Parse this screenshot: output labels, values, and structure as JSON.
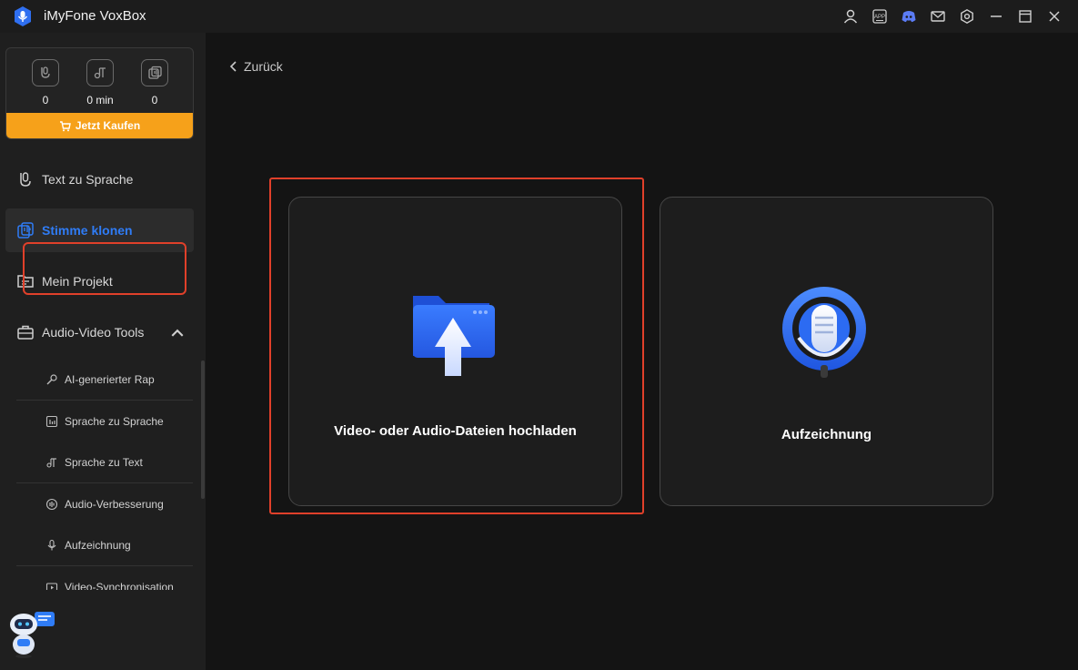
{
  "app": {
    "title": "iMyFone VoxBox"
  },
  "titlebar": {
    "icons": [
      "user-icon",
      "app-icon",
      "discord-icon",
      "mail-icon",
      "settings-icon",
      "minimize-icon",
      "maximize-icon",
      "close-icon"
    ],
    "app_icon_label": "APP"
  },
  "quota": {
    "items": [
      {
        "icon": "text-to-speech-quota-icon",
        "value": "0"
      },
      {
        "icon": "time-quota-icon",
        "value": "0 min"
      },
      {
        "icon": "voice-clone-quota-icon",
        "value": "0"
      }
    ],
    "buy_label": "Jetzt Kaufen",
    "buy_color": "#f6a11a"
  },
  "nav": {
    "items": [
      {
        "label": "Text zu Sprache",
        "icon": "text-to-speech-icon"
      },
      {
        "label": "Stimme klonen",
        "icon": "voice-clone-icon",
        "active": true
      },
      {
        "label": "Mein Projekt",
        "icon": "folder-icon"
      },
      {
        "label": "Audio-Video Tools",
        "icon": "toolbox-icon",
        "expanded": true
      }
    ],
    "sub_items": [
      {
        "label": "AI-generierter Rap",
        "icon": "mic-rap-icon"
      },
      {
        "label": "Sprache zu Sprache",
        "icon": "speech-to-speech-icon"
      },
      {
        "label": "Sprache zu Text",
        "icon": "speech-to-text-icon"
      },
      {
        "label": "Audio-Verbesserung",
        "icon": "audio-enhance-icon"
      },
      {
        "label": "Aufzeichnung",
        "icon": "record-icon"
      },
      {
        "label": "Video-Synchronisation",
        "icon": "video-sync-icon"
      }
    ],
    "active_color": "#2f7cf6"
  },
  "main": {
    "back_label": "Zurück",
    "cards": [
      {
        "title": "Video- oder Audio-Dateien hochladen",
        "icon": "upload-folder-icon",
        "highlighted": true
      },
      {
        "title": "Aufzeichnung",
        "icon": "microphone-icon"
      }
    ],
    "highlight_color": "#e0402a"
  }
}
